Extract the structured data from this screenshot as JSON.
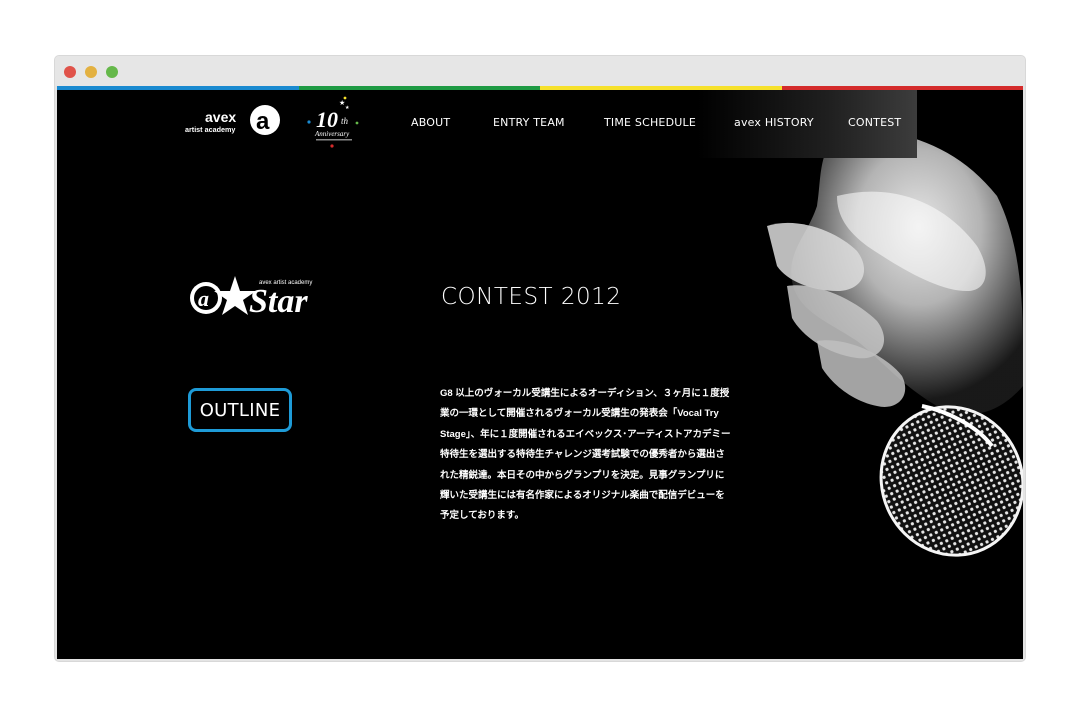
{
  "colors": {
    "window_dots": [
      "#e0534a",
      "#e3b141",
      "#65b84a"
    ],
    "stripes": [
      "#1a8ad0",
      "#1e9a43",
      "#f6e12b",
      "#d42b2b"
    ],
    "accent": "#1e9bd7"
  },
  "header": {
    "logo_avex": {
      "top": "avex",
      "bottom": "artist academy",
      "mark": "a"
    },
    "logo_10th": {
      "number": "10",
      "suffix": "th",
      "word": "Anniversary"
    },
    "nav": [
      {
        "label": "ABOUT"
      },
      {
        "label": "ENTRY TEAM"
      },
      {
        "label": "TIME SCHEDULE"
      },
      {
        "label": "avex HISTORY"
      },
      {
        "label": "CONTEST"
      }
    ]
  },
  "main": {
    "brand_logo": {
      "mark": "a",
      "word": "Star",
      "tag": "avex artist academy"
    },
    "title": "CONTEST 2012",
    "outline_label": "OUTLINE",
    "description_lines": [
      "G8 以上のヴォーカル受講生によるオーディション、３ヶ月に１度授",
      "業の一環として開催されるヴォーカル受講生の発表会「Vocal Try",
      "Stage」、年に１度開催されるエイベックス･アーティストアカデミー",
      "特待生を選出する特待生チャレンジ選考試験での優秀者から選出さ",
      "れた精鋭達。本日その中からグランプリを決定。見事グランプリに",
      "輝いた受講生には有名作家によるオリジナル楽曲で配信デビューを",
      "予定しております。"
    ]
  },
  "decor": {
    "photo": "microphone-hand-photo"
  }
}
